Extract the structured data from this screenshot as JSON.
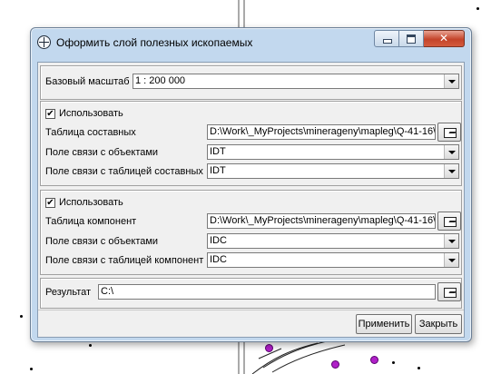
{
  "window": {
    "title": "Оформить слой полезных ископаемых"
  },
  "base_scale": {
    "label": "Базовый масштаб",
    "value": "1 : 200 000"
  },
  "section1": {
    "use_label": "Использовать",
    "use_checked": true,
    "table_label": "Таблица составных",
    "table_value": "D:\\Work\\_MyProjects\\minerageny\\mapleg\\Q-41-16\\",
    "obj_link_label": "Поле связи с объектами",
    "obj_link_value": "IDT",
    "table_link_label": "Поле связи с таблицей составных",
    "table_link_value": "IDT"
  },
  "section2": {
    "use_label": "Использовать",
    "use_checked": true,
    "table_label": "Таблица компонент",
    "table_value": "D:\\Work\\_MyProjects\\minerageny\\mapleg\\Q-41-16\\",
    "obj_link_label": "Поле связи с объектами",
    "obj_link_value": "IDC",
    "table_link_label": "Поле связи с таблицей компонент",
    "table_link_value": "IDC"
  },
  "result": {
    "label": "Результат",
    "value": "C:\\"
  },
  "buttons": {
    "apply": "Применить",
    "close": "Закрыть"
  },
  "icons": {
    "app": "app-globe-icon",
    "browse": "folder-open-icon"
  }
}
